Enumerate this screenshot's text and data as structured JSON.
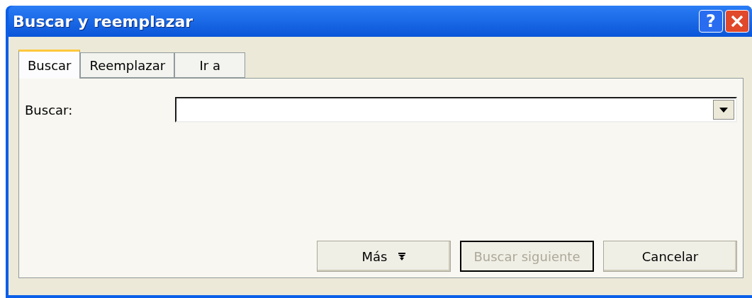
{
  "window": {
    "title": "Buscar y reemplazar",
    "help_button": "?"
  },
  "tabs": [
    {
      "label": "Buscar",
      "selected": true
    },
    {
      "label": "Reemplazar",
      "selected": false
    },
    {
      "label": "Ir a",
      "selected": false
    }
  ],
  "search": {
    "label": "Buscar:"
  },
  "buttons": [
    {
      "label": "Más",
      "kind": "more",
      "disabled": false,
      "default": false
    },
    {
      "label": "Buscar siguiente",
      "kind": "plain",
      "disabled": true,
      "default": true
    },
    {
      "label": "Cancelar",
      "kind": "plain",
      "disabled": false,
      "default": false
    }
  ]
}
